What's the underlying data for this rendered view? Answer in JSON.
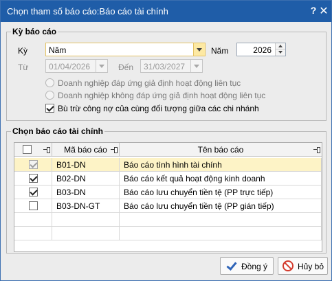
{
  "window": {
    "title": "Chọn tham số báo cáo:Báo cáo tài chính",
    "help_label": "?",
    "close_label": "✕"
  },
  "period_group": {
    "title": "Kỳ báo cáo",
    "ky_label": "Kỳ",
    "ky_value": "Năm",
    "nam_label": "Năm",
    "nam_value": "2026",
    "tu_label": "Từ",
    "tu_value": "01/04/2026",
    "den_label": "Đến",
    "den_value": "31/03/2027",
    "radio1_label": "Doanh nghiệp đáp ứng giả định hoạt động liên tục",
    "radio2_label": "Doanh nghiệp không đáp ứng giả định hoạt động liên tục",
    "offset_label": "Bù trừ công nợ của cùng đối tượng giữa các chi nhánh",
    "offset_checked": true
  },
  "report_group": {
    "title": "Chọn báo cáo tài chính",
    "columns": [
      "",
      "Mã báo cáo",
      "Tên báo cáo"
    ],
    "rows": [
      {
        "code": "B01-DN",
        "name": "Báo cáo tình hình tài chính",
        "checked": true,
        "disabled": true,
        "selected": true
      },
      {
        "code": "B02-DN",
        "name": "Báo cáo kết quả hoạt động kinh doanh",
        "checked": true,
        "disabled": false,
        "selected": false
      },
      {
        "code": "B03-DN",
        "name": "Báo cáo lưu chuyển tiền tệ (PP trực tiếp)",
        "checked": true,
        "disabled": false,
        "selected": false
      },
      {
        "code": "B03-DN-GT",
        "name": "Báo cáo lưu chuyển tiền tệ (PP gián tiếp)",
        "checked": false,
        "disabled": false,
        "selected": false
      }
    ]
  },
  "buttons": {
    "ok_label": "Đồng ý",
    "cancel_label": "Hủy bỏ"
  },
  "colors": {
    "titlebar": "#1f5da8",
    "selected_row": "#fdf3c6",
    "cancel_icon": "#d33a2c",
    "ok_icon": "#2f64b8"
  }
}
